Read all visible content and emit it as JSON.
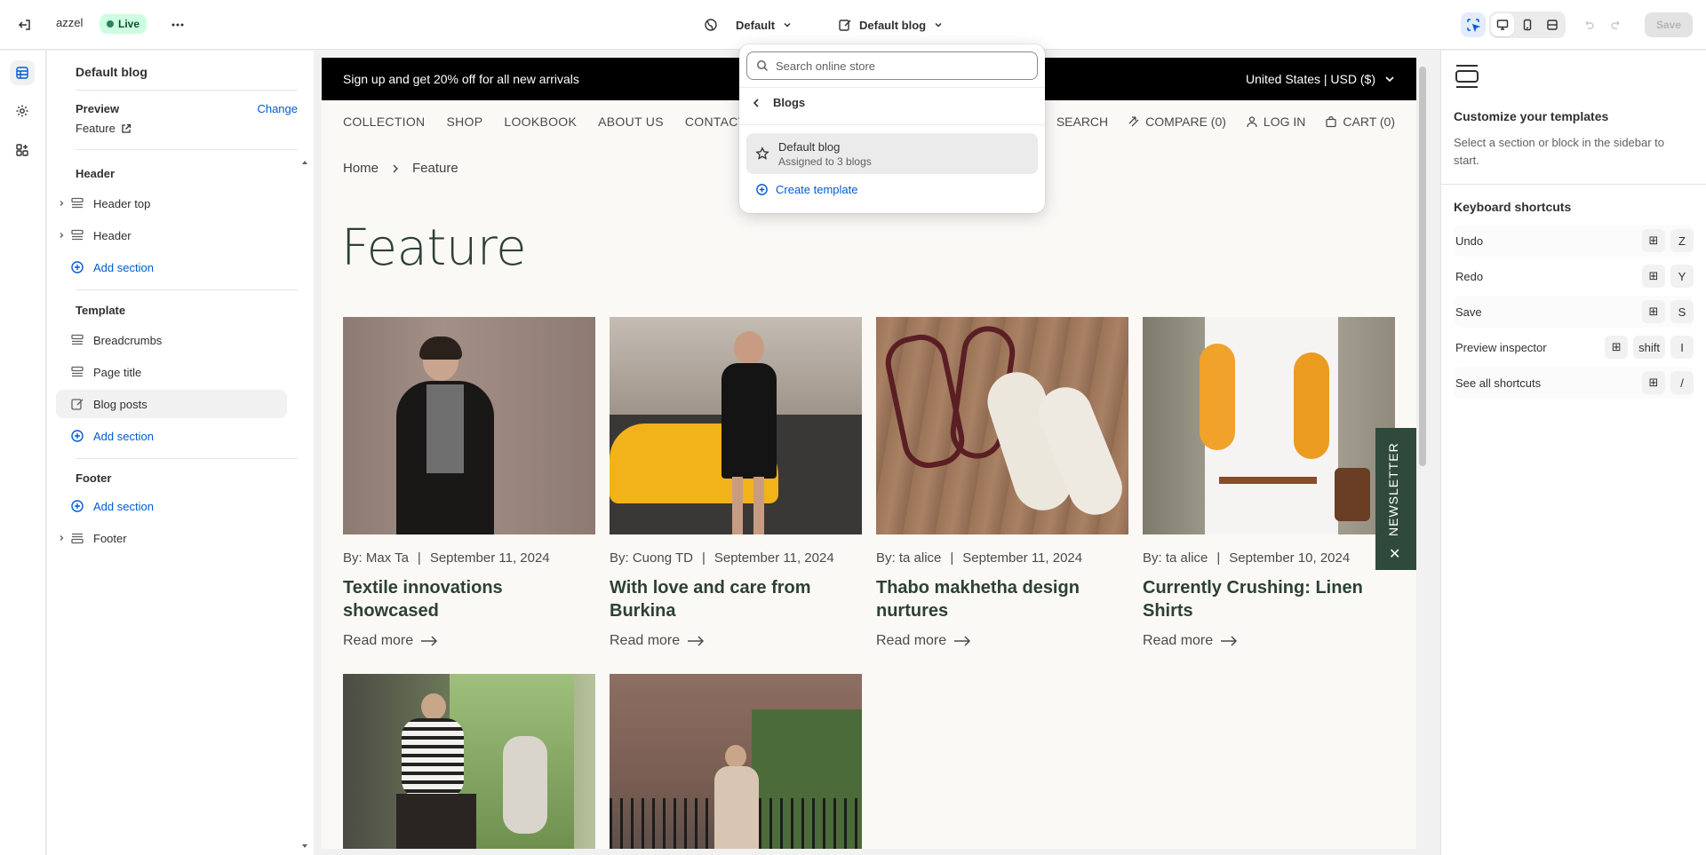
{
  "topbar": {
    "store_name": "azzel",
    "status_label": "Live",
    "theme_select": "Default",
    "template_select": "Default blog",
    "save_label": "Save"
  },
  "sidebar": {
    "title": "Default blog",
    "preview_label": "Preview",
    "change_link": "Change",
    "preview_value": "Feature",
    "header_group": {
      "heading": "Header",
      "items": [
        "Header top",
        "Header"
      ],
      "add_section": "Add section"
    },
    "template_group": {
      "heading": "Template",
      "items": [
        "Breadcrumbs",
        "Page title",
        "Blog posts"
      ],
      "add_section": "Add section"
    },
    "footer_group": {
      "heading": "Footer",
      "add_section": "Add section",
      "items": [
        "Footer"
      ]
    }
  },
  "popup": {
    "search_placeholder": "Search online store",
    "header": "Blogs",
    "option_title": "Default blog",
    "option_subtitle": "Assigned to 3 blogs",
    "create_label": "Create template"
  },
  "preview": {
    "announcement": "Sign up and get 20% off for all new arrivals",
    "currency": "United States | USD ($)",
    "nav": [
      "COLLECTION",
      "SHOP",
      "LOOKBOOK",
      "ABOUT US",
      "CONTACT US"
    ],
    "nav_right": {
      "search": "SEARCH",
      "compare": "COMPARE (0)",
      "login": "LOG IN",
      "cart": "CART (0)"
    },
    "breadcrumb": {
      "home": "Home",
      "current": "Feature"
    },
    "page_title": "Feature",
    "posts": [
      {
        "author": "By: Max Ta",
        "date": "September 11, 2024",
        "title": "Textile innovations showcased",
        "read_more": "Read more"
      },
      {
        "author": "By: Cuong TD",
        "date": "September 11, 2024",
        "title": "With love and care from Burkina",
        "read_more": "Read more"
      },
      {
        "author": "By: ta alice",
        "date": "September 11, 2024",
        "title": "Thabo makhetha design nurtures",
        "read_more": "Read more"
      },
      {
        "author": "By: ta alice",
        "date": "September 10, 2024",
        "title": "Currently Crushing: Linen Shirts",
        "read_more": "Read more"
      }
    ],
    "newsletter": "NEWSLETTER"
  },
  "right_panel": {
    "title": "Customize your templates",
    "description": "Select a section or block in the sidebar to start.",
    "shortcuts_heading": "Keyboard shortcuts",
    "shortcuts": [
      {
        "label": "Undo",
        "keys": [
          "⊞",
          "Z"
        ]
      },
      {
        "label": "Redo",
        "keys": [
          "⊞",
          "Y"
        ]
      },
      {
        "label": "Save",
        "keys": [
          "⊞",
          "S"
        ]
      },
      {
        "label": "Preview inspector",
        "keys": [
          "⊞",
          "shift",
          "I"
        ]
      },
      {
        "label": "See all shortcuts",
        "keys": [
          "⊞",
          "/"
        ]
      }
    ]
  },
  "colors": {
    "accent": "#005bd3",
    "brand_green": "#2d4133",
    "live_bg": "#cdfee1"
  }
}
